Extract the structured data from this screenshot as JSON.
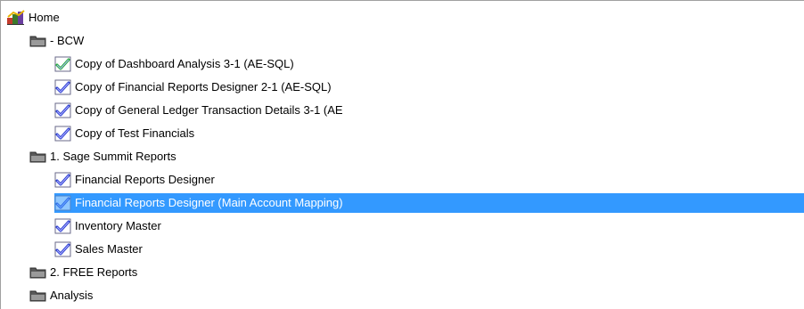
{
  "tree": {
    "root": {
      "label": "Home",
      "icon": "home-icon"
    },
    "items": [
      {
        "label": " - BCW",
        "type": "folder",
        "icon": "folder-icon",
        "level": 1,
        "selected": false
      },
      {
        "label": "Copy of Dashboard Analysis 3-1 (AE-SQL)",
        "type": "report",
        "icon": "report-green-check-icon",
        "level": 2,
        "selected": false
      },
      {
        "label": "Copy of Financial Reports Designer 2-1 (AE-SQL)",
        "type": "report",
        "icon": "report-icon",
        "level": 2,
        "selected": false
      },
      {
        "label": "Copy of General Ledger Transaction Details 3-1 (AE",
        "type": "report",
        "icon": "report-icon",
        "level": 2,
        "selected": false
      },
      {
        "label": "Copy of Test Financials",
        "type": "report",
        "icon": "report-icon",
        "level": 2,
        "selected": false
      },
      {
        "label": "1. Sage Summit Reports",
        "type": "folder",
        "icon": "folder-icon",
        "level": 1,
        "selected": false
      },
      {
        "label": "Financial Reports Designer",
        "type": "report",
        "icon": "report-icon",
        "level": 2,
        "selected": false
      },
      {
        "label": "Financial Reports Designer (Main Account Mapping)",
        "type": "report",
        "icon": "report-faded-icon",
        "level": 2,
        "selected": true
      },
      {
        "label": "Inventory Master",
        "type": "report",
        "icon": "report-icon",
        "level": 2,
        "selected": false
      },
      {
        "label": "Sales Master",
        "type": "report",
        "icon": "report-icon",
        "level": 2,
        "selected": false
      },
      {
        "label": "2. FREE Reports",
        "type": "folder",
        "icon": "folder-icon",
        "level": 1,
        "selected": false
      },
      {
        "label": "Analysis",
        "type": "folder",
        "icon": "folder-icon",
        "level": 1,
        "selected": false
      }
    ]
  },
  "colors": {
    "selection_bg": "#3399ff",
    "selection_text": "#ffffff",
    "folder": "#5a5a5a",
    "check_blue": "#2b3fd1",
    "check_green": "#27b23a"
  }
}
